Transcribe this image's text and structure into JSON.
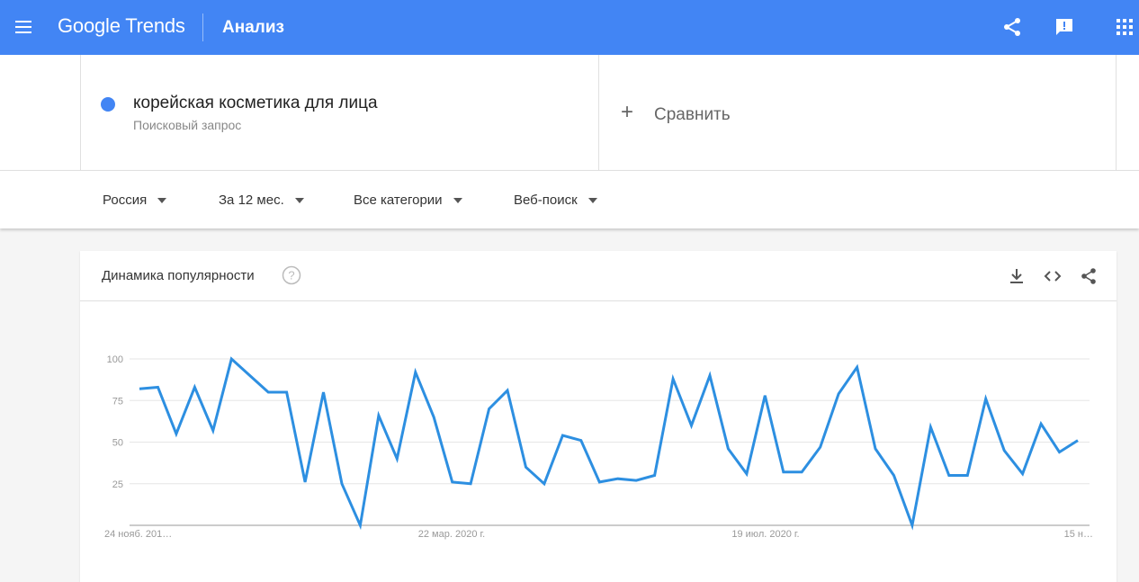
{
  "header": {
    "logo": "Google Trends",
    "title": "Анализ",
    "brand_color": "#4285f4"
  },
  "search_term": {
    "name": "корейская косметика для лица",
    "type": "Поисковый запрос",
    "color": "#4285f4"
  },
  "compare": {
    "icon": "plus-icon",
    "label": "Сравнить"
  },
  "filters": [
    {
      "label": "Россия"
    },
    {
      "label": "За 12 мес."
    },
    {
      "label": "Все категории"
    },
    {
      "label": "Веб-поиск"
    }
  ],
  "widget": {
    "title": "Динамика популярности",
    "icons": [
      "help-icon",
      "download-icon",
      "embed-code-icon",
      "share-icon"
    ]
  },
  "chart_data": {
    "type": "line",
    "title": "",
    "xlabel": "",
    "ylabel": "",
    "ylim": [
      0,
      100
    ],
    "yticks": [
      25,
      50,
      75,
      100
    ],
    "grid": true,
    "line_color": "#2d8fe1",
    "x_tick_labels": [
      "24 нояб. 201…",
      "22 мар. 2020 г.",
      "19 июл. 2020 г.",
      "15 н…"
    ],
    "series": [
      {
        "values": [
          82,
          83,
          55,
          83,
          57,
          100,
          90,
          80,
          80,
          26,
          80,
          25,
          0,
          66,
          40,
          92,
          65,
          26,
          25,
          70,
          81,
          35,
          25,
          54,
          51,
          26,
          28,
          27,
          30,
          88,
          60,
          90,
          46,
          31,
          78,
          32,
          32,
          47,
          79,
          95,
          46,
          30,
          0,
          59,
          30,
          30,
          76,
          45,
          31,
          61,
          44,
          51
        ]
      }
    ]
  }
}
